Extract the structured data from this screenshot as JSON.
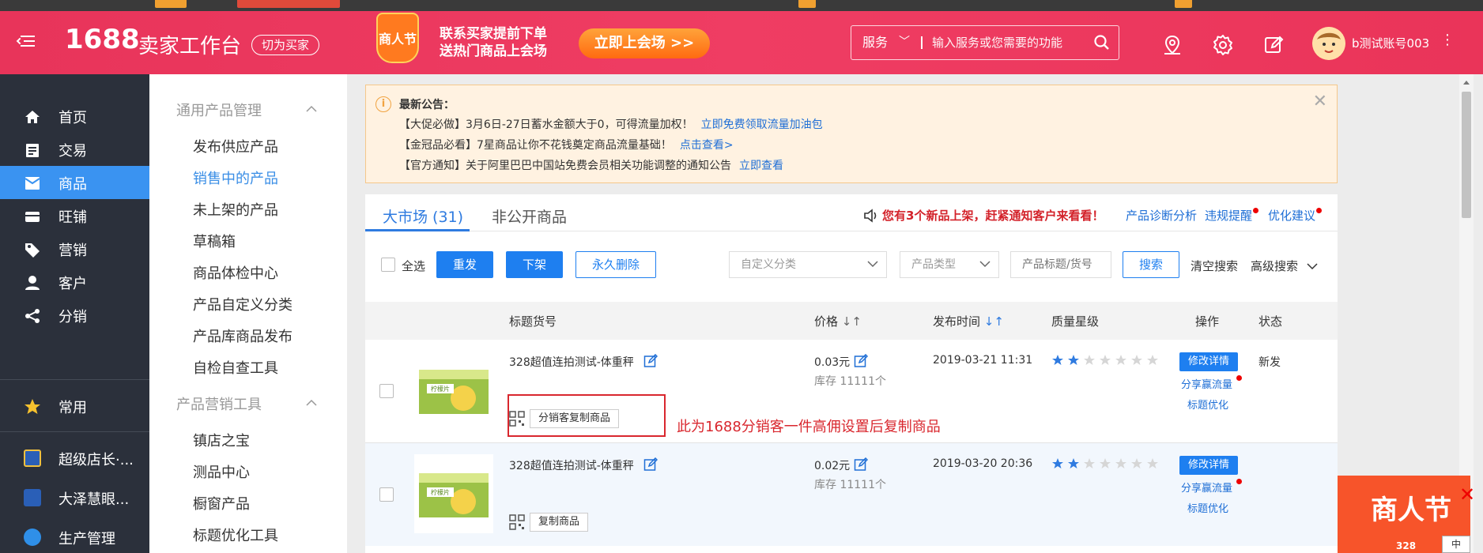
{
  "header": {
    "logo": "1688",
    "logo_sub": "卖家工作台",
    "switch_label": "切为买家",
    "promo_badge": "商人节",
    "promo_line1": "联系买家提前下单",
    "promo_line2": "送热门商品上会场",
    "promo_button": "立即上会场 >>",
    "search_category": "服务",
    "search_placeholder": "输入服务或您需要的功能",
    "account_name": "b测试账号003",
    "icons": [
      "location-icon",
      "gear-icon",
      "edit-icon"
    ]
  },
  "leftnav": {
    "items": [
      {
        "label": "首页",
        "icon": "home-icon"
      },
      {
        "label": "交易",
        "icon": "clipboard-icon"
      },
      {
        "label": "商品",
        "icon": "box-icon",
        "active": true
      },
      {
        "label": "旺铺",
        "icon": "shop-icon"
      },
      {
        "label": "营销",
        "icon": "tag-icon"
      },
      {
        "label": "客户",
        "icon": "user-icon"
      },
      {
        "label": "分销",
        "icon": "share-icon"
      }
    ],
    "common": {
      "label": "常用",
      "icon": "star-icon"
    },
    "apps": [
      {
        "label": "超级店长·...",
        "color": "#2a5fb7"
      },
      {
        "label": "大泽慧眼...",
        "color": "#2a5fb7"
      },
      {
        "label": "生产管理",
        "color": "#2f8fe8"
      }
    ]
  },
  "subnav": {
    "group1_title": "通用产品管理",
    "group1_items": [
      "发布供应产品",
      "销售中的产品",
      "未上架的产品",
      "草稿箱",
      "商品体检中心",
      "产品自定义分类",
      "产品库商品发布",
      "自检自查工具"
    ],
    "group1_active_index": 1,
    "group2_title": "产品营销工具",
    "group2_items": [
      "镇店之宝",
      "测品中心",
      "橱窗产品",
      "标题优化工具"
    ]
  },
  "notice": {
    "title": "最新公告：",
    "lines": [
      {
        "text": "【大促必做】3月6日-27日蓄水金额大于0，可得流量加权！",
        "link": "立即免费领取流量加油包"
      },
      {
        "text": "【金冠品必看】7星商品让你不花钱奠定商品流量基础！",
        "link": "点击查看>"
      },
      {
        "text": "【官方通知】关于阿里巴巴中国站免费会员相关功能调整的通知公告",
        "link": "立即查看"
      }
    ]
  },
  "tabs": [
    {
      "label": "大市场 (31)",
      "active": true
    },
    {
      "label": "非公开商品",
      "active": false
    }
  ],
  "alert": {
    "prefix": "您有",
    "count": "3",
    "suffix": "个新品上架，赶紧通知客户来看看！"
  },
  "top_links": [
    "产品诊断分析",
    "违规提醒",
    "优化建议"
  ],
  "toolbar": {
    "select_all": "全选",
    "republish": "重发",
    "delist": "下架",
    "delete": "永久删除",
    "custom_category": "自定义分类",
    "product_type": "产品类型",
    "keyword_placeholder": "产品标题/货号",
    "search": "搜索",
    "clear": "清空搜索",
    "advanced": "高级搜索"
  },
  "table": {
    "headers": [
      "标题货号",
      "价格",
      "发布时间",
      "质量星级",
      "操作",
      "状态"
    ],
    "rows": [
      {
        "title": "328超值连拍测试-体重秤",
        "price": "0.03元",
        "stock": "库存 11111个",
        "time": "2019-03-21 11:31",
        "stars": 2,
        "op_button": "修改详情",
        "op_link1": "分享赢流量",
        "op_link2": "标题优化",
        "status": "新发",
        "copy_label": "分销客复制商品"
      },
      {
        "title": "328超值连拍测试-体重秤",
        "price": "0.02元",
        "stock": "库存 11111个",
        "time": "2019-03-20 20:36",
        "stars": 2,
        "op_button": "修改详情",
        "op_link1": "分享赢流量",
        "op_link2": "标题优化",
        "status": "",
        "copy_label": "复制商品"
      }
    ],
    "thumb_text": "柠檬片"
  },
  "annotation": "此为1688分销客一件高佣设置后复制商品",
  "float_promo": {
    "text": "商人节",
    "num": "328",
    "ime": "中"
  },
  "colors": {
    "header": "#ea3459",
    "nav_bg": "#2b303b",
    "active": "#3a93f1",
    "link": "#1f6fd6",
    "alert": "#d3222a"
  }
}
